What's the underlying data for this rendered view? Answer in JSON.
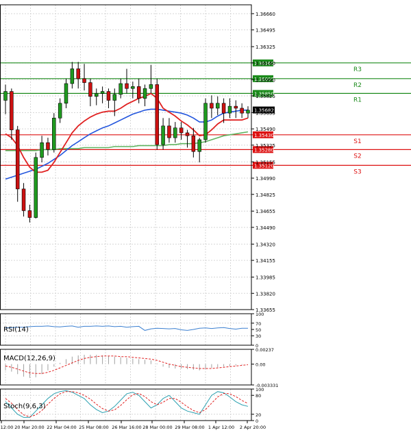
{
  "chart_data": {
    "type": "candlestick",
    "title": "",
    "price_axis": {
      "ticks": [
        "1.36660",
        "1.36495",
        "1.36325",
        "1.36160",
        "1.35990",
        "1.35825",
        "1.35655",
        "1.35490",
        "1.35325",
        "1.35155",
        "1.34990",
        "1.34825",
        "1.34655",
        "1.34490",
        "1.34320",
        "1.34155",
        "1.33985",
        "1.33820",
        "1.33655"
      ],
      "ylim": [
        1.33655,
        1.3675
      ]
    },
    "time_axis": {
      "labels": [
        "12:00",
        "20 Mar 20:00",
        "22 Mar 04:00",
        "25 Mar 08:00",
        "26 Mar 16:00",
        "28 Mar 00:00",
        "29 Mar 08:00",
        "1 Apr 12:00",
        "2 Apr 20:00"
      ]
    },
    "levels": [
      {
        "name": "R3",
        "value": "1.36160",
        "price": 1.3616,
        "color": "#1a8a1a"
      },
      {
        "name": "R2",
        "value": "1.36000",
        "price": 1.36,
        "color": "#1a8a1a"
      },
      {
        "name": "R1",
        "value": "1.35850",
        "price": 1.3585,
        "color": "#1a8a1a"
      },
      {
        "name": "S1",
        "value": "1.35430",
        "price": 1.3543,
        "color": "#dd1111"
      },
      {
        "name": "S2",
        "value": "1.35280",
        "price": 1.3528,
        "color": "#dd1111"
      },
      {
        "name": "S3",
        "value": "1.35120",
        "price": 1.3512,
        "color": "#dd1111"
      }
    ],
    "current_price": {
      "value": "1.35682",
      "price": 1.35682
    },
    "candles": [
      [
        1.3578,
        1.3594,
        1.3564,
        1.3587
      ],
      [
        1.3587,
        1.359,
        1.3538,
        1.3548
      ],
      [
        1.3548,
        1.3552,
        1.3475,
        1.3488
      ],
      [
        1.3488,
        1.3494,
        1.346,
        1.3466
      ],
      [
        1.3466,
        1.3472,
        1.3454,
        1.3459
      ],
      [
        1.3459,
        1.3525,
        1.3458,
        1.352
      ],
      [
        1.352,
        1.3542,
        1.3515,
        1.3535
      ],
      [
        1.3535,
        1.354,
        1.3522,
        1.3528
      ],
      [
        1.3528,
        1.3565,
        1.3525,
        1.356
      ],
      [
        1.356,
        1.358,
        1.3555,
        1.3575
      ],
      [
        1.3575,
        1.36,
        1.357,
        1.3595
      ],
      [
        1.3595,
        1.3617,
        1.359,
        1.361
      ],
      [
        1.361,
        1.3617,
        1.359,
        1.36
      ],
      [
        1.36,
        1.3615,
        1.3588,
        1.3596
      ],
      [
        1.3596,
        1.36,
        1.3572,
        1.3582
      ],
      [
        1.3582,
        1.359,
        1.3573,
        1.3585
      ],
      [
        1.3585,
        1.3592,
        1.3575,
        1.3587
      ],
      [
        1.3587,
        1.359,
        1.357,
        1.3578
      ],
      [
        1.3578,
        1.359,
        1.3562,
        1.3584
      ],
      [
        1.3584,
        1.36,
        1.358,
        1.3595
      ],
      [
        1.3595,
        1.361,
        1.3585,
        1.359
      ],
      [
        1.359,
        1.3597,
        1.358,
        1.3592
      ],
      [
        1.3592,
        1.36,
        1.3575,
        1.358
      ],
      [
        1.358,
        1.3594,
        1.3572,
        1.359
      ],
      [
        1.359,
        1.3614,
        1.3585,
        1.3594
      ],
      [
        1.3594,
        1.36,
        1.3528,
        1.3533
      ],
      [
        1.3533,
        1.356,
        1.3528,
        1.3552
      ],
      [
        1.3552,
        1.356,
        1.3535,
        1.354
      ],
      [
        1.354,
        1.3556,
        1.3535,
        1.355
      ],
      [
        1.355,
        1.3556,
        1.3538,
        1.3545
      ],
      [
        1.3545,
        1.3548,
        1.353,
        1.3542
      ],
      [
        1.3542,
        1.355,
        1.352,
        1.3526
      ],
      [
        1.3526,
        1.354,
        1.3515,
        1.3538
      ],
      [
        1.3538,
        1.358,
        1.3535,
        1.3575
      ],
      [
        1.3575,
        1.3583,
        1.356,
        1.357
      ],
      [
        1.357,
        1.3582,
        1.3563,
        1.3575
      ],
      [
        1.3575,
        1.358,
        1.3555,
        1.3565
      ],
      [
        1.3565,
        1.358,
        1.356,
        1.3572
      ],
      [
        1.3572,
        1.3578,
        1.356,
        1.357
      ],
      [
        1.357,
        1.3575,
        1.356,
        1.3565
      ],
      [
        1.3565,
        1.3572,
        1.356,
        1.3568
      ]
    ],
    "ma_red": [
      1.3544,
      1.354,
      1.3532,
      1.352,
      1.351,
      1.3505,
      1.3505,
      1.3507,
      1.3515,
      1.3525,
      1.3535,
      1.3545,
      1.3552,
      1.3557,
      1.3561,
      1.3564,
      1.3566,
      1.3567,
      1.3567,
      1.357,
      1.3574,
      1.3577,
      1.358,
      1.3582,
      1.3585,
      1.358,
      1.357,
      1.3566,
      1.3562,
      1.3557,
      1.3553,
      1.3548,
      1.3542,
      1.3543,
      1.3548,
      1.3554,
      1.3558,
      1.3558,
      1.3558,
      1.3558,
      1.356
    ],
    "ma_blue": [
      1.3498,
      1.35,
      1.3502,
      1.3504,
      1.3506,
      1.3508,
      1.3511,
      1.3514,
      1.3518,
      1.3522,
      1.3527,
      1.3532,
      1.3536,
      1.354,
      1.3544,
      1.3547,
      1.355,
      1.3552,
      1.3555,
      1.3558,
      1.3561,
      1.3564,
      1.3566,
      1.3568,
      1.3569,
      1.3569,
      1.3568,
      1.3567,
      1.3566,
      1.3565,
      1.3563,
      1.356,
      1.3556,
      1.3556,
      1.3558,
      1.3562,
      1.3565,
      1.3566,
      1.3567,
      1.3568,
      1.3568
    ],
    "ma_green": [
      1.3527,
      1.3527,
      1.3527,
      1.3527,
      1.3527,
      1.3527,
      1.3528,
      1.3528,
      1.3528,
      1.3529,
      1.3529,
      1.3529,
      1.3529,
      1.353,
      1.353,
      1.353,
      1.353,
      1.353,
      1.3531,
      1.3531,
      1.3531,
      1.3531,
      1.3532,
      1.3532,
      1.3532,
      1.3532,
      1.3532,
      1.3533,
      1.3533,
      1.3534,
      1.3534,
      1.3534,
      1.3535,
      1.3536,
      1.3538,
      1.354,
      1.3542,
      1.3543,
      1.3544,
      1.3545,
      1.3546
    ],
    "indicators": {
      "rsi": {
        "label": "RSI(14)",
        "ticks": [
          "100",
          "70",
          "50",
          "30",
          "0"
        ],
        "ylim": [
          0,
          100
        ],
        "values": [
          55,
          56,
          57,
          57,
          59,
          60,
          60,
          61,
          59,
          58,
          60,
          61,
          57,
          60,
          60,
          61,
          60,
          61,
          59,
          60,
          57,
          59,
          60,
          47,
          52,
          54,
          53,
          52,
          53,
          49,
          47,
          50,
          54,
          55,
          53,
          55,
          56,
          53,
          51,
          54,
          54
        ]
      },
      "macd": {
        "label": "MACD(12,26,9)",
        "ticks": [
          "0.00237",
          "0.00",
          "-0.003331"
        ],
        "ylim": [
          -0.003331,
          0.00237
        ],
        "histogram": [
          -0.001,
          -0.0012,
          -0.0016,
          -0.002,
          -0.0022,
          -0.0021,
          -0.0016,
          -0.001,
          -0.0004,
          0.0002,
          0.0008,
          0.0012,
          0.0014,
          0.0015,
          0.0015,
          0.0015,
          0.0014,
          0.0013,
          0.0012,
          0.0011,
          0.001,
          0.0009,
          0.0008,
          0.0007,
          0.0006,
          0.0001,
          -0.0004,
          -0.0006,
          -0.0007,
          -0.0007,
          -0.0008,
          -0.0009,
          -0.001,
          -0.0008,
          -0.0006,
          -0.0005,
          -0.0004,
          -0.0003,
          -0.0002,
          -0.0001,
          0.0
        ],
        "signal": [
          -0.0003,
          -0.0005,
          -0.0008,
          -0.0011,
          -0.0014,
          -0.0015,
          -0.0015,
          -0.0013,
          -0.001,
          -0.0006,
          -0.0002,
          0.0002,
          0.0006,
          0.0009,
          0.0011,
          0.0012,
          0.0013,
          0.0013,
          0.0013,
          0.0012,
          0.0012,
          0.0011,
          0.001,
          0.0009,
          0.0008,
          0.0006,
          0.0003,
          0.0,
          -0.0002,
          -0.0004,
          -0.0005,
          -0.0006,
          -0.0007,
          -0.0007,
          -0.0007,
          -0.0006,
          -0.0005,
          -0.0004,
          -0.0003,
          -0.0002,
          -0.0001
        ]
      },
      "stoch": {
        "label": "Stoch(9,6,3)",
        "ticks": [
          "100",
          "80",
          "20",
          "0"
        ],
        "ylim": [
          0,
          100
        ],
        "main": [
          60,
          40,
          20,
          10,
          10,
          30,
          50,
          70,
          85,
          92,
          95,
          90,
          80,
          70,
          50,
          35,
          25,
          30,
          45,
          65,
          85,
          90,
          80,
          60,
          40,
          50,
          70,
          80,
          60,
          40,
          30,
          25,
          20,
          50,
          80,
          92,
          88,
          75,
          60,
          50,
          45
        ],
        "signal": [
          70,
          55,
          35,
          18,
          12,
          18,
          32,
          52,
          70,
          85,
          92,
          92,
          88,
          80,
          68,
          52,
          38,
          30,
          34,
          48,
          66,
          82,
          86,
          76,
          60,
          50,
          58,
          70,
          70,
          58,
          44,
          32,
          25,
          35,
          55,
          75,
          86,
          85,
          76,
          64,
          54
        ]
      }
    }
  }
}
